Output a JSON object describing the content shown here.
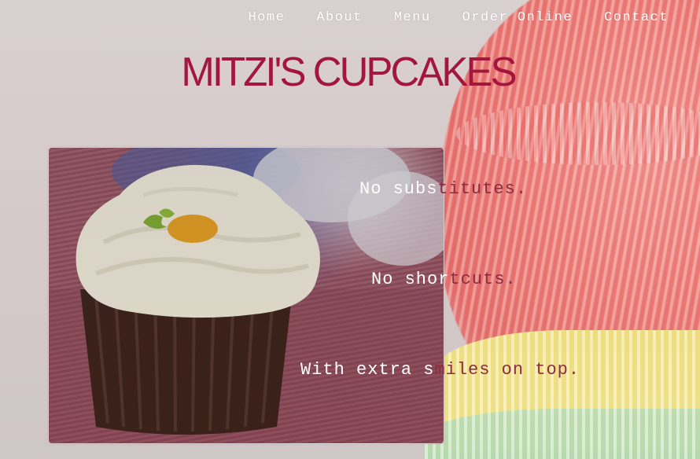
{
  "nav": {
    "items": [
      {
        "label": "Home"
      },
      {
        "label": "About"
      },
      {
        "label": "Menu"
      },
      {
        "label": "Order Online"
      },
      {
        "label": "Contact"
      }
    ]
  },
  "header": {
    "title": "MITZI'S CUPCAKES"
  },
  "hero": {
    "image": "cupcake-photo",
    "taglines": [
      {
        "white": "No subs",
        "dark": "titutes."
      },
      {
        "white": "No shor",
        "dark": "tcuts."
      },
      {
        "white": "With extra s",
        "dark": "miles on top."
      }
    ]
  },
  "colors": {
    "title": "#a3163e",
    "nav": "#ffffff",
    "tagline_dark": "#8c2b41"
  }
}
